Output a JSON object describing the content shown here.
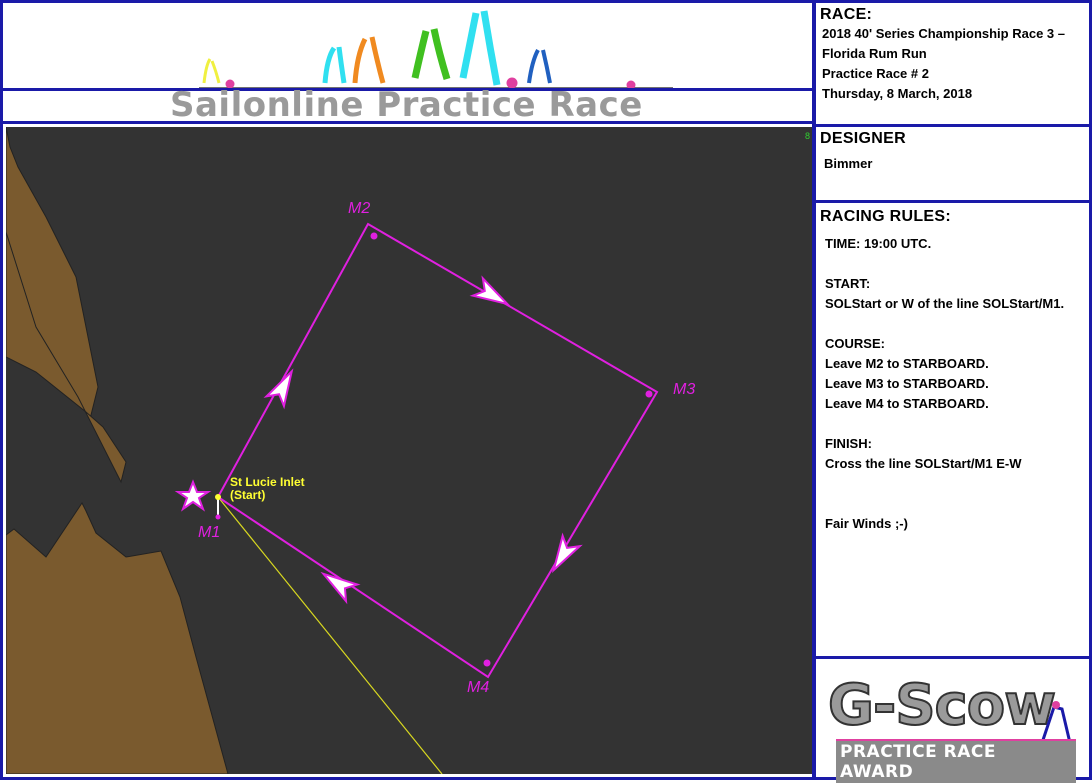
{
  "banner": {
    "title": "Sailonline Practice Race"
  },
  "race": {
    "heading": "RACE:",
    "line1": "2018 40' Series Championship Race 3 –",
    "line2": "Florida Rum Run",
    "line3": "Practice Race # 2",
    "line4": "Thursday, 8 March, 2018"
  },
  "designer": {
    "heading": "DESIGNER",
    "name": "Bimmer"
  },
  "rules": {
    "heading": "RACING RULES:",
    "time": "TIME:  19:00 UTC.",
    "start_head": "START:",
    "start_text": "SOLStart or W of the line SOLStart/M1.",
    "course_head": "COURSE:",
    "course_1": "Leave M2 to STARBOARD.",
    "course_2": "Leave M3 to STARBOARD.",
    "course_3": "Leave M4 to STARBOARD.",
    "finish_head": "FINISH:",
    "finish_text": "Cross the line SOLStart/M1 E-W",
    "closing": "Fair Winds ;-)"
  },
  "map": {
    "start_label_1": "St Lucie Inlet",
    "start_label_2": "(Start)",
    "marks": [
      "M1",
      "M2",
      "M3",
      "M4"
    ],
    "corner_tick": "8"
  },
  "logo": {
    "main": "G-Scow",
    "sub": "PRACTICE RACE AWARD"
  },
  "colors": {
    "border": "#1a1aa8",
    "course": "#e020e0",
    "land": "#7a5a2e",
    "water": "#333333",
    "start_label": "#ffff33"
  }
}
